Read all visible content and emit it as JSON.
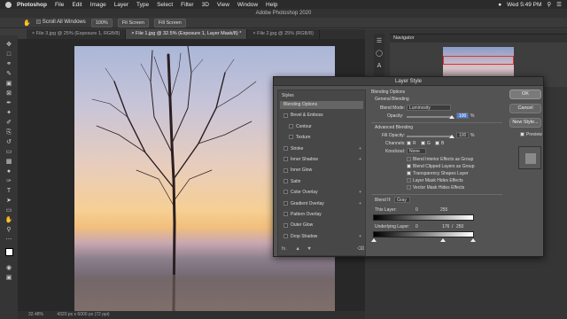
{
  "menubar": {
    "app": "Photoshop",
    "items": [
      "File",
      "Edit",
      "Image",
      "Layer",
      "Type",
      "Select",
      "Filter",
      "3D",
      "View",
      "Window",
      "Help"
    ],
    "clock": "Wed 5:49 PM"
  },
  "window_title": "Adobe Photoshop 2020",
  "options": {
    "scroll_all": "Scroll All Windows",
    "zoom": "100%",
    "fit_screen": "Fit Screen",
    "fill_screen": "Fill Screen"
  },
  "tabs": [
    {
      "label": "File 3.jpg @ 25% (Exposure 1, RGB/8)"
    },
    {
      "label": "File 1.jpg @ 32.5% (Exposure 1, Layer Mask/8) *"
    },
    {
      "label": "File 2.jpg @ 25% (RGB/8)"
    }
  ],
  "status": {
    "zoom": "32.48%",
    "doc": "4320 px x 6000 px (72 ppi)"
  },
  "navigator": {
    "title": "Navigator"
  },
  "dialog": {
    "title": "Layer Style",
    "styles_header": "Styles",
    "styles": [
      {
        "label": "Blending Options",
        "selected": true,
        "checkbox": false,
        "plus": false,
        "indent": false
      },
      {
        "label": "Bevel & Emboss",
        "selected": false,
        "checkbox": true,
        "plus": false,
        "indent": false
      },
      {
        "label": "Contour",
        "selected": false,
        "checkbox": true,
        "plus": false,
        "indent": true
      },
      {
        "label": "Texture",
        "selected": false,
        "checkbox": true,
        "plus": false,
        "indent": true
      },
      {
        "label": "Stroke",
        "selected": false,
        "checkbox": true,
        "plus": true,
        "indent": false
      },
      {
        "label": "Inner Shadow",
        "selected": false,
        "checkbox": true,
        "plus": true,
        "indent": false
      },
      {
        "label": "Inner Glow",
        "selected": false,
        "checkbox": true,
        "plus": false,
        "indent": false
      },
      {
        "label": "Satin",
        "selected": false,
        "checkbox": true,
        "plus": false,
        "indent": false
      },
      {
        "label": "Color Overlay",
        "selected": false,
        "checkbox": true,
        "plus": true,
        "indent": false
      },
      {
        "label": "Gradient Overlay",
        "selected": false,
        "checkbox": true,
        "plus": true,
        "indent": false
      },
      {
        "label": "Pattern Overlay",
        "selected": false,
        "checkbox": true,
        "plus": false,
        "indent": false
      },
      {
        "label": "Outer Glow",
        "selected": false,
        "checkbox": true,
        "plus": false,
        "indent": false
      },
      {
        "label": "Drop Shadow",
        "selected": false,
        "checkbox": true,
        "plus": true,
        "indent": false
      }
    ],
    "fx_label": "fx.",
    "blending_options": "Blending Options",
    "general_blending": "General Blending",
    "blend_mode_label": "Blend Mode:",
    "blend_mode_value": "Luminosity",
    "opacity_label": "Opacity:",
    "opacity_value": "100",
    "percent": "%",
    "advanced_blending": "Advanced Blending",
    "fill_opacity_label": "Fill Opacity:",
    "fill_opacity_value": "100",
    "channels_label": "Channels:",
    "channel_r": "R",
    "channel_g": "G",
    "channel_b": "B",
    "knockout_label": "Knockout:",
    "knockout_value": "None",
    "options": [
      {
        "label": "Blend Interior Effects as Group",
        "checked": false
      },
      {
        "label": "Blend Clipped Layers as Group",
        "checked": true
      },
      {
        "label": "Transparency Shapes Layer",
        "checked": true
      },
      {
        "label": "Layer Mask Hides Effects",
        "checked": false
      },
      {
        "label": "Vector Mask Hides Effects",
        "checked": false
      }
    ],
    "blend_if_label": "Blend If:",
    "blend_if_value": "Gray",
    "this_layer_label": "This Layer:",
    "this_layer_low": "0",
    "this_layer_high": "255",
    "underlying_label": "Underlying Layer:",
    "underlying_low": "0",
    "underlying_mid": "176",
    "underlying_sep": "/",
    "underlying_high": "250",
    "buttons": {
      "ok": "OK",
      "cancel": "Cancel",
      "new_style": "New Style...",
      "preview": "Preview"
    }
  }
}
